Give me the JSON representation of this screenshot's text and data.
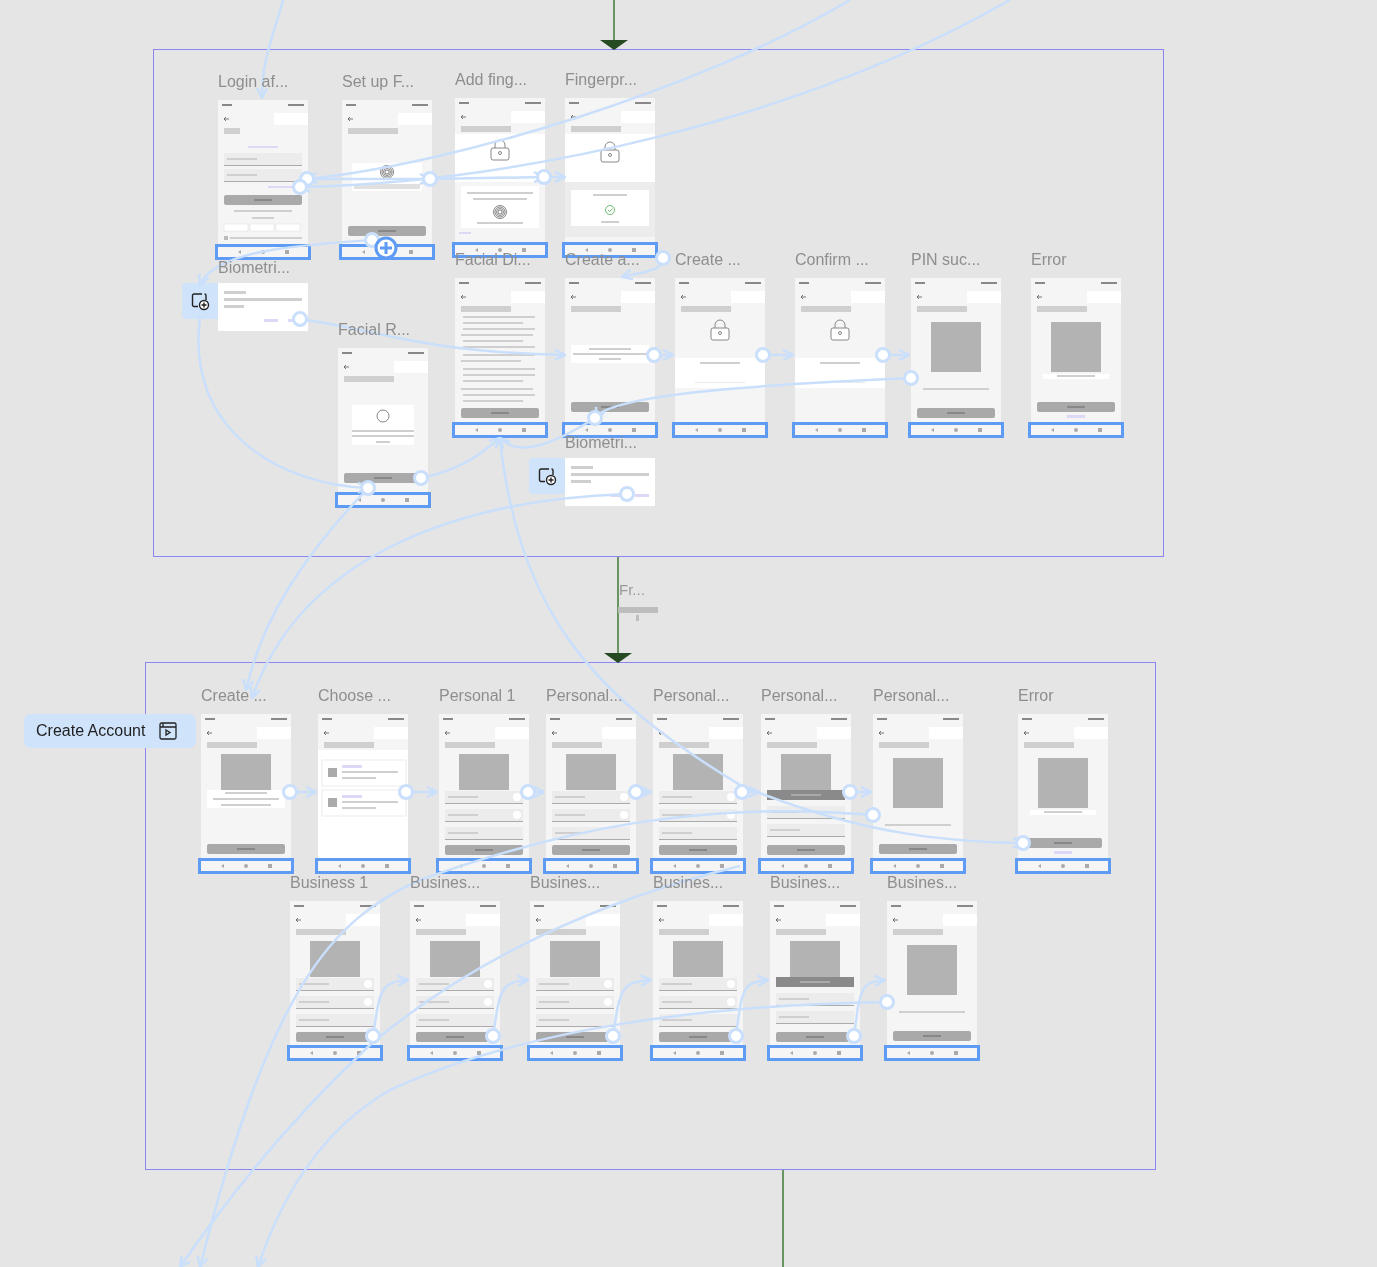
{
  "sections": [
    {
      "frames": [
        {
          "title": "Login af...",
          "kind": "login"
        },
        {
          "title": "Set up F...",
          "kind": "fingerprint-setup"
        },
        {
          "title": "Add fing...",
          "kind": "fingerprint"
        },
        {
          "title": "Fingerpr...",
          "kind": "lock-check"
        },
        {
          "title": "Biometri...",
          "kind": "sheet"
        },
        {
          "title": "Facial Di...",
          "kind": "text"
        },
        {
          "title": "Create a...",
          "kind": "card"
        },
        {
          "title": "Create ...",
          "kind": "lock"
        },
        {
          "title": "Confirm ...",
          "kind": "lock"
        },
        {
          "title": "PIN suc...",
          "kind": "image"
        },
        {
          "title": "Error",
          "kind": "error-image"
        },
        {
          "title": "Facial R...",
          "kind": "face"
        },
        {
          "title": "Biometri...",
          "kind": "sheet"
        }
      ]
    },
    {
      "frames": [
        {
          "title": "Create ...",
          "kind": "image-card"
        },
        {
          "title": "Choose ...",
          "kind": "list"
        },
        {
          "title": "Personal 1",
          "kind": "form-image"
        },
        {
          "title": "Personal...",
          "kind": "form-image"
        },
        {
          "title": "Personal...",
          "kind": "form-image"
        },
        {
          "title": "Personal...",
          "kind": "banner-form"
        },
        {
          "title": "Personal...",
          "kind": "image"
        },
        {
          "title": "Error",
          "kind": "error-image"
        },
        {
          "title": "Business 1",
          "kind": "form-image"
        },
        {
          "title": "Busines...",
          "kind": "form-image"
        },
        {
          "title": "Busines...",
          "kind": "form-image"
        },
        {
          "title": "Busines...",
          "kind": "form-image"
        },
        {
          "title": "Busines...",
          "kind": "banner-form"
        },
        {
          "title": "Busines...",
          "kind": "image"
        }
      ]
    }
  ],
  "start_point": {
    "label": "Create Account"
  },
  "connection_label": "Fr..."
}
